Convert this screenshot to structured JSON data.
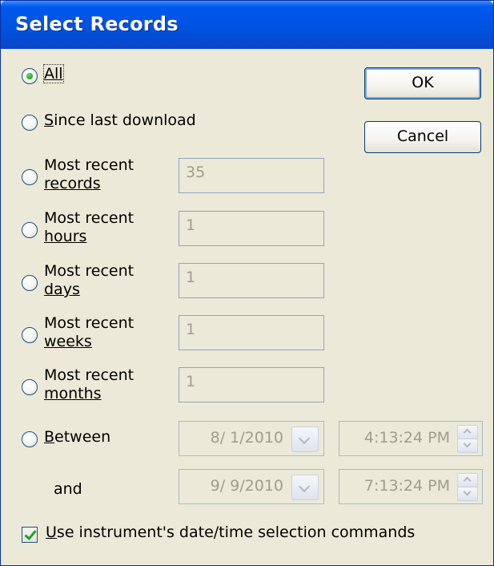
{
  "window": {
    "title": "Select Records"
  },
  "buttons": {
    "ok": "OK",
    "cancel": "Cancel"
  },
  "options": {
    "all": {
      "label": "All",
      "selected": true
    },
    "since_last": {
      "label": "Since last download"
    },
    "records": {
      "line1": "Most recent",
      "line2": "records",
      "value": "35"
    },
    "hours": {
      "line1": "Most recent",
      "line2": "hours",
      "value": "1"
    },
    "days": {
      "line1": "Most recent",
      "line2": "days",
      "value": "1"
    },
    "weeks": {
      "line1": "Most recent",
      "line2": "weeks",
      "value": "1"
    },
    "months": {
      "line1": "Most recent",
      "line2": "months",
      "value": "1"
    },
    "between": {
      "label": "Between",
      "start_date": "8/ 1/2010",
      "start_time": "4:13:24 PM"
    },
    "and": {
      "label": "and",
      "end_date": "9/ 9/2010",
      "end_time": "7:13:24 PM"
    }
  },
  "checkbox": {
    "label": "Use instrument's date/time selection commands",
    "checked": true
  },
  "colors": {
    "titlebar": "#0058ee",
    "dialog_bg": "#ece9d8",
    "disabled_text": "#a09c90",
    "radio_dot": "#21a121"
  }
}
